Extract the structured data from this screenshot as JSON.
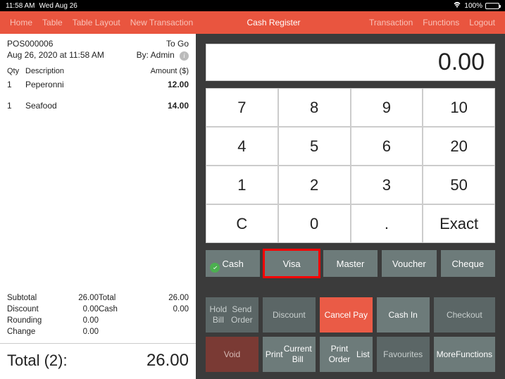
{
  "statusbar": {
    "time": "11:58 AM",
    "date": "Wed Aug 26",
    "battery": "100%"
  },
  "navbar": {
    "left": [
      "Home",
      "Table",
      "Table Layout",
      "New Transaction"
    ],
    "title": "Cash Register",
    "right": [
      "Transaction",
      "Functions",
      "Logout"
    ]
  },
  "receipt": {
    "pos_id": "POS000006",
    "order_type": "To Go",
    "datetime": "Aug 26, 2020 at 11:58 AM",
    "by_label": "By: Admin",
    "columns": {
      "qty": "Qty",
      "desc": "Description",
      "amount": "Amount ($)"
    },
    "items": [
      {
        "qty": "1",
        "desc": "Peperonni",
        "amount": "12.00"
      },
      {
        "qty": "1",
        "desc": "Seafood",
        "amount": "14.00"
      }
    ],
    "summary": {
      "subtotal_label": "Subtotal",
      "subtotal": "26.00",
      "total_label": "Total",
      "total": "26.00",
      "discount_label": "Discount",
      "discount": "0.00",
      "cash_label": "Cash",
      "cash": "0.00",
      "rounding_label": "Rounding",
      "rounding": "0.00",
      "change_label": "Change",
      "change": "0.00"
    },
    "total_bar": {
      "label": "Total (2):",
      "value": "26.00"
    }
  },
  "register": {
    "display": "0.00",
    "keys": [
      "7",
      "8",
      "9",
      "10",
      "4",
      "5",
      "6",
      "20",
      "1",
      "2",
      "3",
      "50",
      "C",
      "0",
      ".",
      "Exact"
    ],
    "payments": [
      {
        "label": "Cash",
        "checked": true,
        "active": false
      },
      {
        "label": "Visa",
        "checked": false,
        "active": true
      },
      {
        "label": "Master",
        "checked": false,
        "active": false
      },
      {
        "label": "Voucher",
        "checked": false,
        "active": false
      },
      {
        "label": "Cheque",
        "checked": false,
        "active": false
      }
    ],
    "functions": [
      {
        "label": "Hold Bill\nSend Order",
        "style": "dim"
      },
      {
        "label": "Discount",
        "style": "dim"
      },
      {
        "label": "Cancel Pay",
        "style": "danger"
      },
      {
        "label": "Cash In",
        "style": ""
      },
      {
        "label": "Checkout",
        "style": "dim"
      },
      {
        "label": "Void",
        "style": "void"
      },
      {
        "label": "Print\nCurrent Bill",
        "style": ""
      },
      {
        "label": "Print Order\nList",
        "style": ""
      },
      {
        "label": "Favourites",
        "style": "dim"
      },
      {
        "label": "More\nFunctions",
        "style": ""
      }
    ]
  }
}
